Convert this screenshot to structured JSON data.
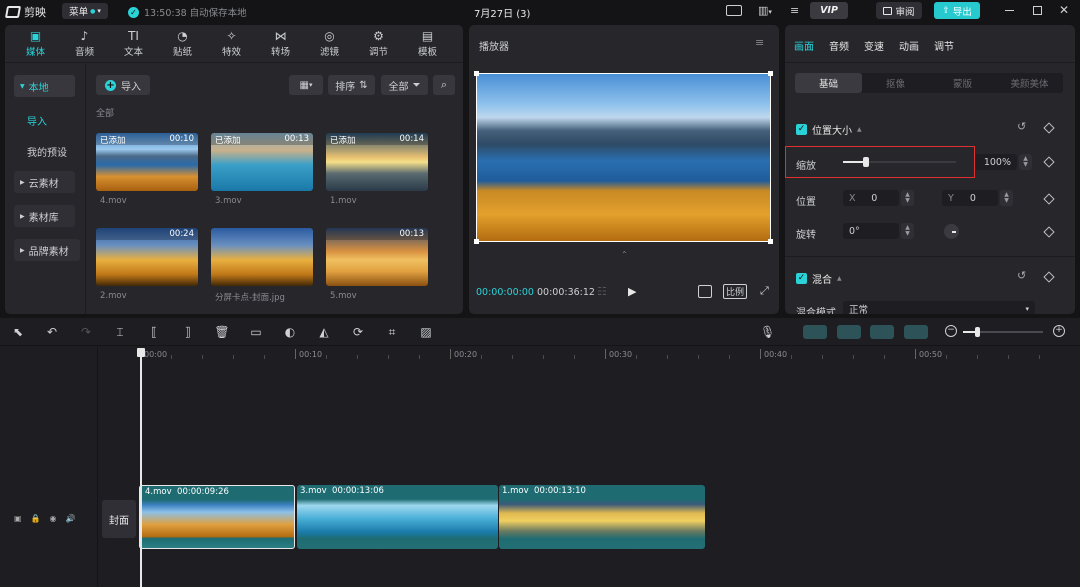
{
  "app": {
    "name": "剪映",
    "menu_label": "菜单",
    "save_status": "13:50:38 自动保存本地",
    "project_title": "7月27日 (3)",
    "vip_label": "VIP",
    "review_label": "审阅",
    "export_label": "导出"
  },
  "media_tabs": [
    {
      "label": "媒体",
      "icon": "media-icon"
    },
    {
      "label": "音频",
      "icon": "audio-icon"
    },
    {
      "label": "文本",
      "icon": "text-icon"
    },
    {
      "label": "贴纸",
      "icon": "sticker-icon"
    },
    {
      "label": "特效",
      "icon": "effects-icon"
    },
    {
      "label": "转场",
      "icon": "transition-icon"
    },
    {
      "label": "滤镜",
      "icon": "filter-icon"
    },
    {
      "label": "调节",
      "icon": "adjust-icon"
    },
    {
      "label": "模板",
      "icon": "template-icon"
    }
  ],
  "sidebar": {
    "local": "本地",
    "import": "导入",
    "presets": "我的预设",
    "cloud": "云素材",
    "library": "素材库",
    "brand": "品牌素材"
  },
  "media_toolbar": {
    "import": "导入",
    "sort": "排序",
    "all": "全部",
    "section": "全部"
  },
  "media_items": [
    {
      "name": "4.mov",
      "added": "已添加",
      "duration": "00:10"
    },
    {
      "name": "3.mov",
      "added": "已添加",
      "duration": "00:13"
    },
    {
      "name": "1.mov",
      "added": "已添加",
      "duration": "00:14"
    },
    {
      "name": "2.mov",
      "added": "",
      "duration": "00:24"
    },
    {
      "name": "分屏卡点-封面.jpg",
      "added": "",
      "duration": ""
    },
    {
      "name": "5.mov",
      "added": "",
      "duration": "00:13"
    }
  ],
  "player": {
    "title": "播放器",
    "current_time": "00:00:00:00",
    "total_time": "00:00:36:12",
    "ratio_label": "比例"
  },
  "inspector": {
    "tabs": [
      "画面",
      "音频",
      "变速",
      "动画",
      "调节"
    ],
    "subtabs": [
      "基础",
      "抠像",
      "蒙版",
      "美颜美体"
    ],
    "position_size": "位置大小",
    "scale_label": "缩放",
    "scale_value": "100%",
    "scale_level": 0.2,
    "position_label": "位置",
    "x_label": "X",
    "x_value": "0",
    "y_label": "Y",
    "y_value": "0",
    "rotate_label": "旋转",
    "rotate_value": "0°",
    "blend_section": "混合",
    "blend_mode_label": "混合模式",
    "blend_mode_value": "正常"
  },
  "timeline": {
    "ruler": [
      "00:00",
      "00:10",
      "00:20",
      "00:30",
      "00:40",
      "00:50"
    ],
    "cover_label": "封面",
    "clips": [
      {
        "name": "4.mov",
        "duration": "00:00:09:26"
      },
      {
        "name": "3.mov",
        "duration": "00:00:13:06"
      },
      {
        "name": "1.mov",
        "duration": "00:00:13:10"
      }
    ]
  },
  "colors": {
    "accent": "#2ad3d8",
    "panel": "#26262b",
    "background": "#141416",
    "highlight_box": "#e03131"
  }
}
